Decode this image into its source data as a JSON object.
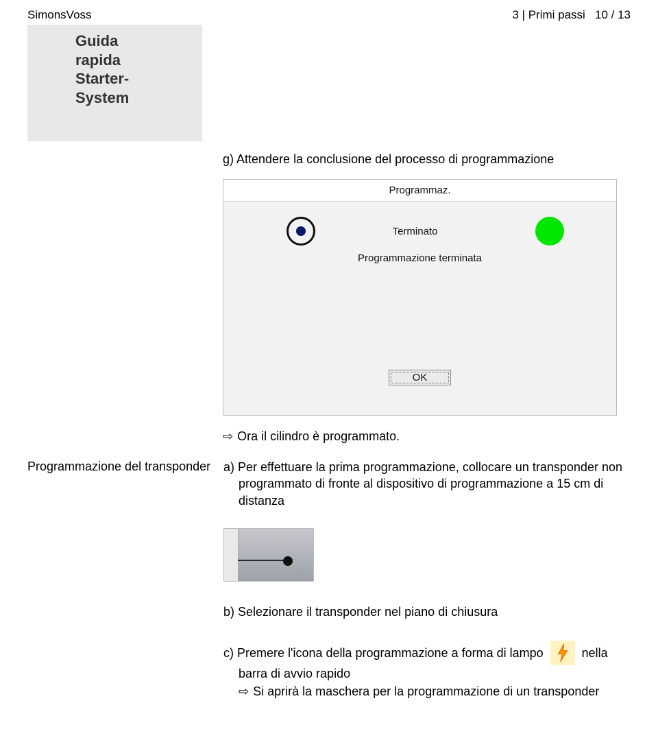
{
  "header": {
    "brand": "SimonsVoss",
    "breadcrumb": "3 | Primi passi",
    "page": "10 / 13"
  },
  "title": {
    "line1": "Guida rapida",
    "line2": "Starter-System"
  },
  "steps": {
    "g": "g) Attendere la conclusione del processo di programmazione",
    "result_g": "Ora il cilindro è programmato.",
    "b": "b) Selezionare il transponder nel piano di chiusura",
    "c_pre": "c) Premere l'icona della programmazione a forma di lampo",
    "c_post": "nella",
    "c_line2": "barra di avvio rapido",
    "result_c": "Si aprirà la maschera per la programmazione di un transponder"
  },
  "left_label": "Programmazione del transponder",
  "step_a": "a) Per effettuare la prima programmazione, collocare un transponder non programmato di fronte al dispositivo di programmazione a 15 cm di distanza",
  "dialog": {
    "title": "Programmaz.",
    "status": "Terminato",
    "message": "Programmazione terminata",
    "ok": "OK"
  },
  "icons": {
    "arrow": "⇨"
  }
}
